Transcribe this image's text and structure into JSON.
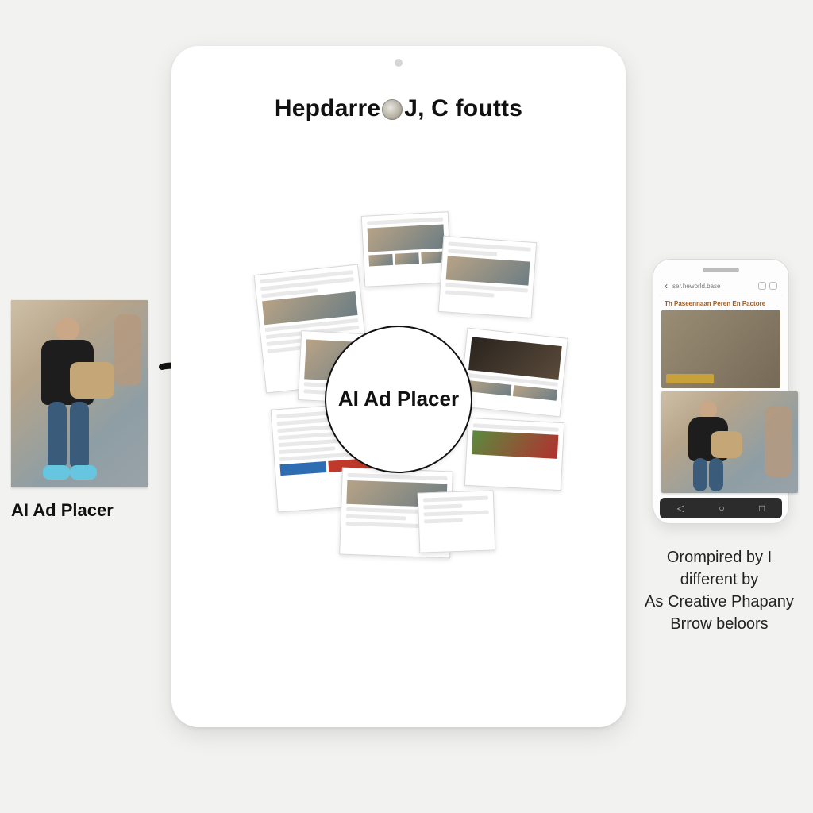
{
  "source": {
    "label": "AI Ad Placer",
    "image_alt": "man-walking-street"
  },
  "arrow": {
    "name": "flow-arrow"
  },
  "tablet": {
    "title_left": "Hepdarre",
    "title_right": "J, C foutts",
    "center_label": "AI Ad Placer"
  },
  "phone": {
    "back_glyph": "‹",
    "url_text": "ser.heworld.base",
    "subtitle": "Th Paseennaan Peren En Pactore",
    "nav": {
      "back": "◁",
      "home": "○",
      "recent": "□"
    }
  },
  "phone_caption": {
    "line1": "Orompired by I",
    "line2": "different by",
    "line3": "As Creative Phapany",
    "line4": "Brrow beloors"
  }
}
